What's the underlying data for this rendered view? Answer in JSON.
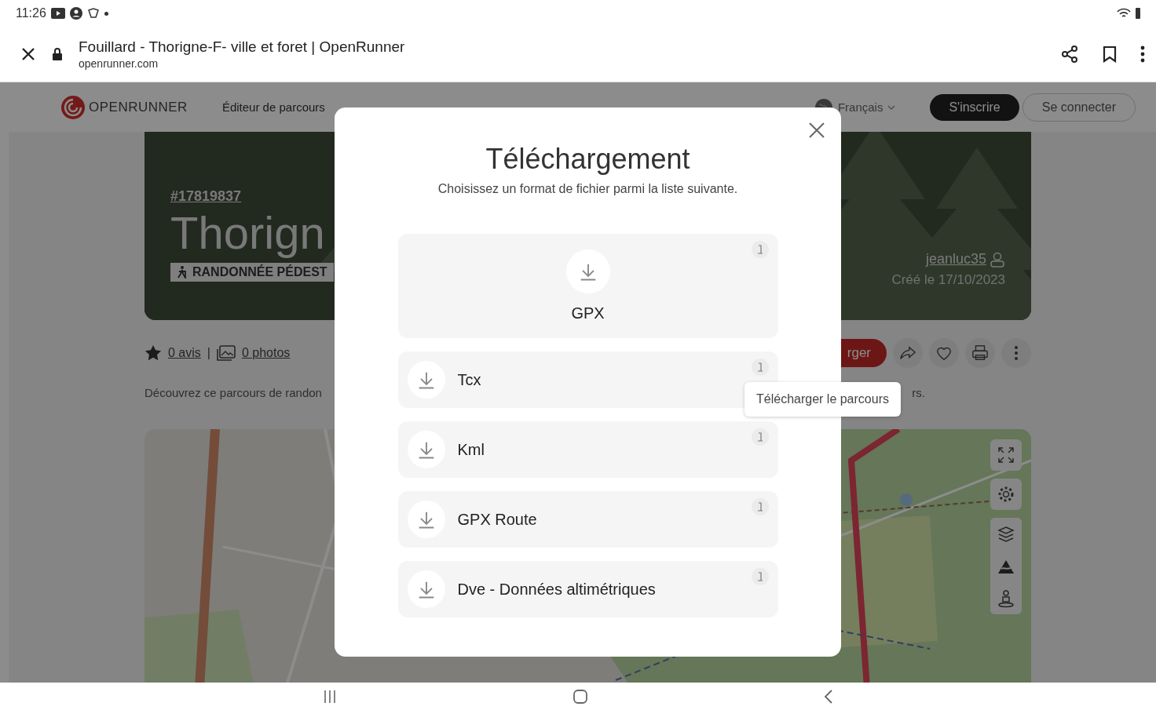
{
  "status_bar": {
    "time": "11:26"
  },
  "browser": {
    "title": "Fouillard - Thorigne-F- ville et foret | OpenRunner",
    "url": "openrunner.com"
  },
  "site_nav": {
    "brand": "OPENRUNNER",
    "links": [
      "Éditeur de parcours"
    ],
    "language": "Français",
    "signup": "S'inscrire",
    "login": "Se connecter"
  },
  "route": {
    "id": "#17819837",
    "title": "Thorign",
    "activity": "RANDONNÉE PÉDEST",
    "author": "jeanluc35",
    "created": "Créé le 17/10/2023",
    "reviews": "0 avis",
    "separator": "|",
    "photos": "0 photos",
    "download_button": "rger",
    "description_start": "Découvrez ce parcours de randon",
    "description_end": "rs."
  },
  "download_dialog": {
    "title": "Téléchargement",
    "subtitle": "Choisissez un format de fichier parmi la liste suivante.",
    "formats": [
      {
        "label": "GPX",
        "kind": "featured"
      },
      {
        "label": "Tcx",
        "kind": "row"
      },
      {
        "label": "Kml",
        "kind": "row"
      },
      {
        "label": "GPX Route",
        "kind": "row"
      },
      {
        "label": "Dve - Données altimétriques",
        "kind": "row"
      }
    ]
  },
  "tooltip": "Télécharger le parcours"
}
